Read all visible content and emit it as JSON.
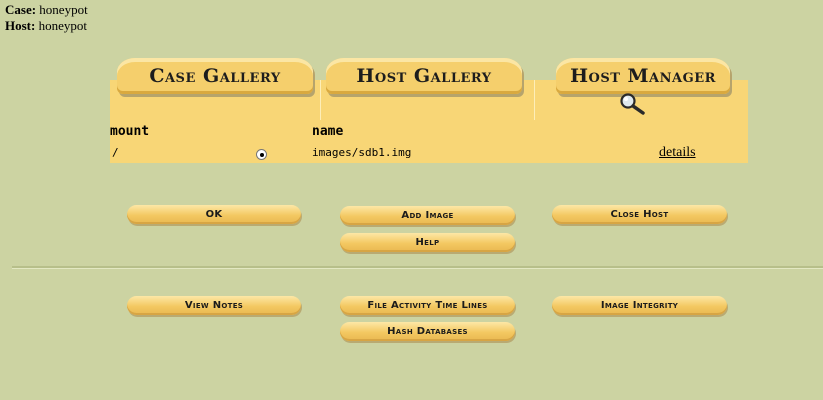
{
  "header": {
    "case_label": "Case:",
    "case_value": "honeypot",
    "host_label": "Host:",
    "host_value": "honeypot"
  },
  "tabs": {
    "case_gallery": "Case Gallery",
    "host_gallery": "Host Gallery",
    "host_manager": "Host Manager"
  },
  "table": {
    "col_mount": "mount",
    "col_name": "name",
    "rows": [
      {
        "mount": "/",
        "name": "images/sdb1.img",
        "details": "details"
      }
    ]
  },
  "buttons": {
    "ok": "OK",
    "add_image": "Add Image",
    "close_host": "Close Host",
    "help": "Help",
    "view_notes": "View Notes",
    "file_activity": "File Activity Time Lines",
    "image_integrity": "Image Integrity",
    "hash_databases": "Hash Databases"
  },
  "icons": {
    "host_manager": "magnifier-icon"
  },
  "colors": {
    "background": "#ccd3a2",
    "panel": "#f8d676",
    "button": "#f3c861"
  }
}
